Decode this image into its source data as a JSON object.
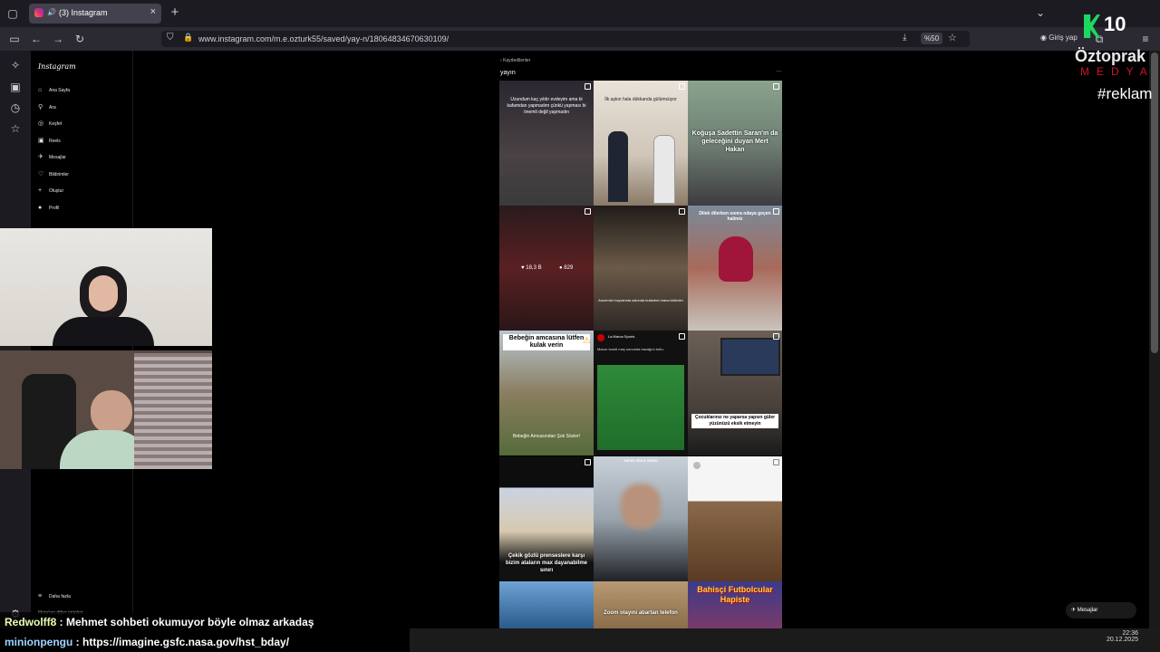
{
  "browser": {
    "tab_title": "(3) Instagram",
    "url": "www.instagram.com/m.e.ozturk55/saved/yay-n/18064834670630109/",
    "zoom": "%50",
    "signin_label": "Giriş yap"
  },
  "instagram": {
    "logo": "Instagram",
    "nav": [
      "Ana Sayfa",
      "Ara",
      "Keşfet",
      "Reels",
      "Mesajlar",
      "Bildirimler",
      "Oluştur",
      "Profil"
    ],
    "more": "Daha fazla",
    "meta": "Meta'nın diğer ürünleri",
    "back_label": "Kaydedilenler",
    "collection_title": "yayın",
    "messages_button": "Mesajlar"
  },
  "grid": {
    "captions": {
      "t1": "Uzundum kaç yıldır evdeyim ama bi kafamdan yapmadım çünkü yapması bi önemli değil yapmadın",
      "t2": "İlk aşkın hala dükkanda gülümsüyor",
      "t3": "Koğuşa Sadettin Saran'ın da geleceğini duyan Mert Hakan",
      "t5_likes": "18,3 B",
      "t5_comments": "829",
      "t6": "Annemler bayramda salonda kutlarken bana bölenler",
      "t7": "Dilek dilerken sonra odaya geçen halimiz",
      "t8_title": "Bebeğin amcasına lütfen kulak verin",
      "t8_bottom": "Bebeğin Amcasından Şok Sözler!",
      "t9_account": "La Marca Sports",
      "t9_text": "Mauro Icardi maç sonunda bacağını tuttu.",
      "t10": "Çocuklarınız ne yaparsa yapsın güler yüzünüzü eksik etmeyin",
      "t11": "Çekik gözlü prenseslere karşı bizim ataların max dayanabilme sınırı",
      "t12": "YAPAY ZEKA VİDEO",
      "t13": "Zoom olayını abartan telefon",
      "t14": "Bahisçi Futbolcular Hapiste"
    }
  },
  "overlay": {
    "brand_number": "10",
    "brand_name": "Öztoprak",
    "brand_sub": "MEDYA",
    "reklam": "#reklam",
    "chat": [
      {
        "user": "Redwolff8",
        "msg": " : Mehmet sohbeti okumuyor böyle olmaz arkadaş"
      },
      {
        "user": "minionpengu",
        "msg": " : https://imagine.gsfc.nasa.gov/hst_bday/"
      }
    ]
  },
  "taskbar": {
    "time": "22:36",
    "date": "20.12.2025"
  }
}
